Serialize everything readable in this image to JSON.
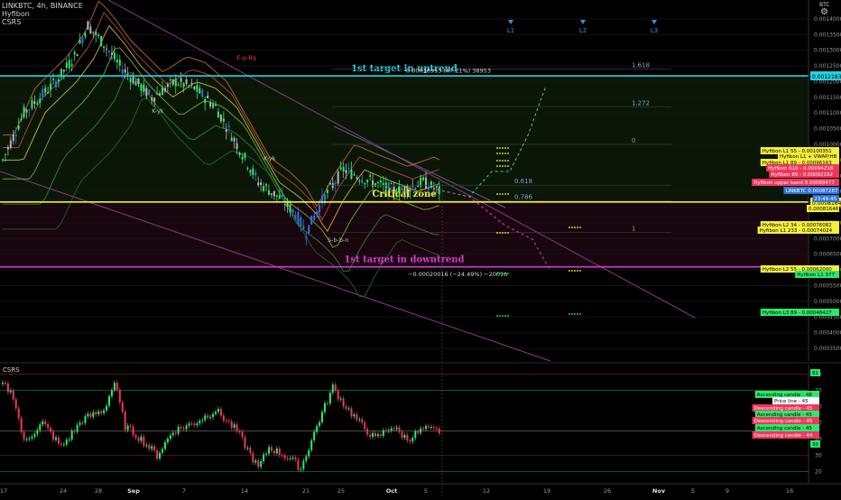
{
  "header": {
    "symbol_line": "LINKBTC, 4h, BINANCE",
    "indicator1": "Hyfibon",
    "indicator2": "CSRS",
    "currency": "BTC",
    "settings_icon": "gear-icon"
  },
  "colors": {
    "background": "#000000",
    "cyan": "#22d4e6",
    "yellow": "#f4ef3a",
    "magenta": "#d63ad6",
    "bull": "#2ee86b",
    "bear": "#f0365c",
    "blue_candle": "#2f74d6"
  },
  "chart_data": [
    {
      "type": "candlestick",
      "title": "LINKBTC, 4h, BINANCE",
      "x_ticks": [
        "17",
        "24",
        "28",
        "Sep",
        "7",
        "14",
        "21",
        "25",
        "Oct",
        "5",
        "12",
        "19",
        "26",
        "Nov",
        "5",
        "9",
        "16"
      ],
      "y_ticks": [
        0.0014,
        0.00135,
        0.0013,
        0.00125,
        0.0012,
        0.00115,
        0.0011,
        0.00105,
        0.001,
        0.00095,
        0.0009,
        0.00085,
        0.0008,
        0.00075,
        0.0007,
        0.00065,
        0.0006,
        0.00055,
        0.0005,
        0.00045,
        0.0004,
        0.00035
      ],
      "ylim": [
        0.00031,
        0.00146
      ],
      "price_path_anchors": [
        [
          0,
          0.00095
        ],
        [
          8,
          0.0011
        ],
        [
          20,
          0.0012
        ],
        [
          27,
          0.00128
        ],
        [
          32,
          0.00138
        ],
        [
          38,
          0.00132
        ],
        [
          44,
          0.00125
        ],
        [
          56,
          0.00115
        ],
        [
          65,
          0.0012
        ],
        [
          72,
          0.00118
        ],
        [
          80,
          0.00112
        ],
        [
          96,
          0.00088
        ],
        [
          104,
          0.00083
        ],
        [
          110,
          0.00078
        ],
        [
          114,
          0.00072
        ],
        [
          120,
          0.00082
        ],
        [
          128,
          0.00092
        ],
        [
          136,
          0.00089
        ],
        [
          148,
          0.00085
        ],
        [
          158,
          0.00088
        ],
        [
          164,
          0.00085
        ]
      ],
      "horizontal_levels": [
        {
          "label": "1st target in uptrend",
          "value": 0.00121834,
          "price_tag": "0.00121834",
          "color": "#22d4e6"
        },
        {
          "label": "Critical zone",
          "value": 0.00081646,
          "price_tag": "0.00081646",
          "color": "#f4ef3a"
        },
        {
          "label": "1st target in downtrend",
          "value": 0.00061,
          "price_tag": "",
          "color": "#d63ad6"
        }
      ],
      "fib_levels": [
        {
          "label": "1.618",
          "value": 0.00124
        },
        {
          "label": "1.272",
          "value": 0.00112
        },
        {
          "label": "0",
          "value": 0.001
        },
        {
          "label": "0.618",
          "value": 0.00087
        },
        {
          "label": "0.786",
          "value": 0.00082
        },
        {
          "label": "1",
          "value": 0.00072
        }
      ],
      "measurements": [
        {
          "text": "0.00038953 (47.21%) 38953",
          "value": 0.00124
        },
        {
          "text": "−0.00020016 (−24.49%) −20016",
          "value": 0.00058
        }
      ],
      "point_labels": [
        {
          "text": "E-p-Bg",
          "x": 88,
          "y": 0.00127
        },
        {
          "text": "K-yk",
          "x": 56,
          "y": 0.0011
        },
        {
          "text": "K-yk",
          "x": 98,
          "y": 0.00095
        },
        {
          "text": "K-yk",
          "x": 145,
          "y": 0.00085
        },
        {
          "text": "S-b-b-n",
          "x": 122,
          "y": 0.00069
        }
      ],
      "time_markers": [
        "L1",
        "L2",
        "L3"
      ],
      "price_tags": [
        {
          "text": "Hyfibon L1 55 - 0.00100351",
          "bg": "#f4ef3a",
          "fg": "#000000"
        },
        {
          "text": "Hyfibon L1 + VWAP/HB",
          "bg": "#f4ef3a",
          "fg": "#000000"
        },
        {
          "text": "Hyfibon L1 89 - 0.00096163",
          "bg": "#f4ef3a",
          "fg": "#000000"
        },
        {
          "text": "Hyfibon 610 - 0.00094218",
          "bg": "#f0365c",
          "fg": "#ffffff"
        },
        {
          "text": "Hyfibon 89 - 0.00092192",
          "bg": "#f0365c",
          "fg": "#ffffff"
        },
        {
          "text": "Hyfibon upper band 0.00089477",
          "bg": "#f0365c",
          "fg": "#ffffff"
        },
        {
          "text": "LINKBTC 0.00087287",
          "bg": "#2f74d6",
          "fg": "#ffffff"
        },
        {
          "text": "23:49:45",
          "bg": "#2f74d6",
          "fg": "#ffffff"
        },
        {
          "text": "0.00081646",
          "bg": "#f4ef3a",
          "fg": "#000000"
        },
        {
          "text": "Hyfibon L2 34 - 0.00076082",
          "bg": "#f4ef3a",
          "fg": "#000000"
        },
        {
          "text": "Hyfibon L1 233 - 0.00074024",
          "bg": "#f4ef3a",
          "fg": "#000000"
        },
        {
          "text": "Hyfibon L2 55 - 0.00062000",
          "bg": "#f4ef3a",
          "fg": "#000000"
        },
        {
          "text": "Hyfibon L1 377",
          "bg": "#2ee86b",
          "fg": "#000000"
        },
        {
          "text": "Hyfibon L3 89 - 0.00048427",
          "bg": "#2ee86b",
          "fg": "#000000"
        }
      ]
    },
    {
      "type": "line",
      "title": "CSRS",
      "y_ticks": [
        80,
        70,
        60,
        50,
        40,
        30,
        20
      ],
      "ylim": [
        13,
        86
      ],
      "levels": [
        {
          "value": 80,
          "color": "#f0365c"
        },
        {
          "value": 70,
          "color": "#2ee86b"
        },
        {
          "value": 45,
          "color": "#c8c8c8"
        },
        {
          "value": 30,
          "color": "#f0365c"
        },
        {
          "value": 20,
          "color": "#2ee86b"
        }
      ],
      "path_anchors": [
        [
          0,
          74
        ],
        [
          4,
          67
        ],
        [
          8,
          38
        ],
        [
          15,
          50
        ],
        [
          22,
          35
        ],
        [
          30,
          52
        ],
        [
          38,
          58
        ],
        [
          42,
          75
        ],
        [
          46,
          48
        ],
        [
          52,
          40
        ],
        [
          58,
          30
        ],
        [
          64,
          45
        ],
        [
          72,
          50
        ],
        [
          80,
          58
        ],
        [
          88,
          45
        ],
        [
          96,
          22
        ],
        [
          100,
          35
        ],
        [
          108,
          28
        ],
        [
          112,
          22
        ],
        [
          118,
          48
        ],
        [
          124,
          72
        ],
        [
          128,
          62
        ],
        [
          134,
          50
        ],
        [
          140,
          40
        ],
        [
          146,
          48
        ],
        [
          152,
          40
        ],
        [
          158,
          46
        ],
        [
          164,
          45
        ]
      ],
      "tags": [
        {
          "text": "Ascending candle - 48",
          "bg": "#2ee86b",
          "fg": "#000000"
        },
        {
          "text": "Price line - 45",
          "bg": "#ffffff",
          "fg": "#000000"
        },
        {
          "text": "Descending candle - 45",
          "bg": "#f0365c",
          "fg": "#ffffff"
        },
        {
          "text": "Ascending candle - 45",
          "bg": "#2ee86b",
          "fg": "#000000"
        },
        {
          "text": "Descending candle - 45",
          "bg": "#f0365c",
          "fg": "#ffffff"
        },
        {
          "text": "Ascending candle - 45",
          "bg": "#2ee86b",
          "fg": "#000000"
        },
        {
          "text": "Descending candle - 44",
          "bg": "#f0365c",
          "fg": "#ffffff"
        }
      ],
      "axis_tags": [
        {
          "text": "82",
          "value": 81,
          "bg": "#2ee86b"
        },
        {
          "text": "30",
          "value": 37,
          "bg": "#2ee86b"
        }
      ]
    }
  ]
}
